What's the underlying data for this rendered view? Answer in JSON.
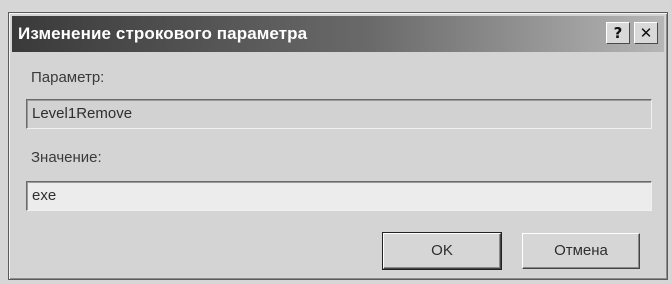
{
  "window": {
    "title": "Изменение строкового параметра",
    "help_label": "?",
    "close_label": "✕"
  },
  "form": {
    "param_label": "Параметр:",
    "param_value": "Level1Remove",
    "value_label": "Значение:",
    "value_value": "exe"
  },
  "buttons": {
    "ok_label": "OK",
    "cancel_label": "Отмена"
  }
}
